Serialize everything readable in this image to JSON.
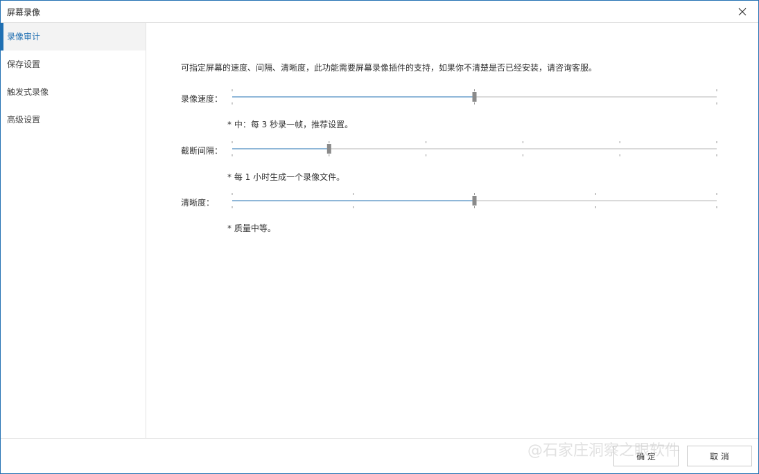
{
  "window": {
    "title": "屏幕录像"
  },
  "sidebar": {
    "items": [
      {
        "label": "录像审计",
        "active": true
      },
      {
        "label": "保存设置",
        "active": false
      },
      {
        "label": "触发式录像",
        "active": false
      },
      {
        "label": "高级设置",
        "active": false
      }
    ]
  },
  "main": {
    "description": "可指定屏幕的速度、间隔、清晰度，此功能需要屏幕录像插件的支持，如果你不清楚是否已经安装，请咨询客服。",
    "sliders": [
      {
        "label": "录像速度：",
        "ticks": 3,
        "value_position": 0.5,
        "note": "* 中：每 3 秒录一帧，推荐设置。"
      },
      {
        "label": "截断间隔：",
        "ticks": 6,
        "value_position": 0.2,
        "note": "* 每 1 小时生成一个录像文件。"
      },
      {
        "label": "清晰度：",
        "ticks": 5,
        "value_position": 0.5,
        "note": "* 质量中等。"
      }
    ]
  },
  "footer": {
    "ok_label": "确 定",
    "cancel_label": "取 消"
  },
  "watermark": "@石家庄洞察之眼软件",
  "colors": {
    "accent": "#1f6fb2",
    "thumb": "#8a8a8a",
    "track": "#b5b5b5",
    "tick": "#999999"
  },
  "icons": {
    "close": "close-icon"
  }
}
